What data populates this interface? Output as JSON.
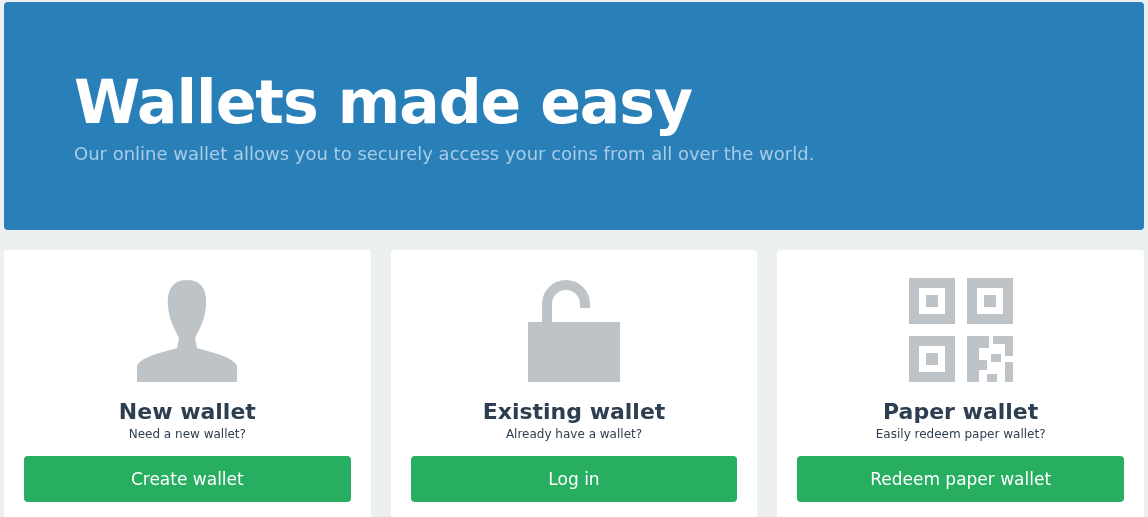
{
  "hero": {
    "title": "Wallets made easy",
    "subtitle": "Our online wallet allows you to securely access your coins from all over the world."
  },
  "cards": [
    {
      "kind": "person",
      "title": "New wallet",
      "subtitle": "Need a new wallet?",
      "button": "Create wallet"
    },
    {
      "kind": "lock",
      "title": "Existing wallet",
      "subtitle": "Already have a wallet?",
      "button": "Log in"
    },
    {
      "kind": "qr",
      "title": "Paper wallet",
      "subtitle": "Easily redeem paper wallet?",
      "button": "Redeem paper wallet"
    }
  ]
}
